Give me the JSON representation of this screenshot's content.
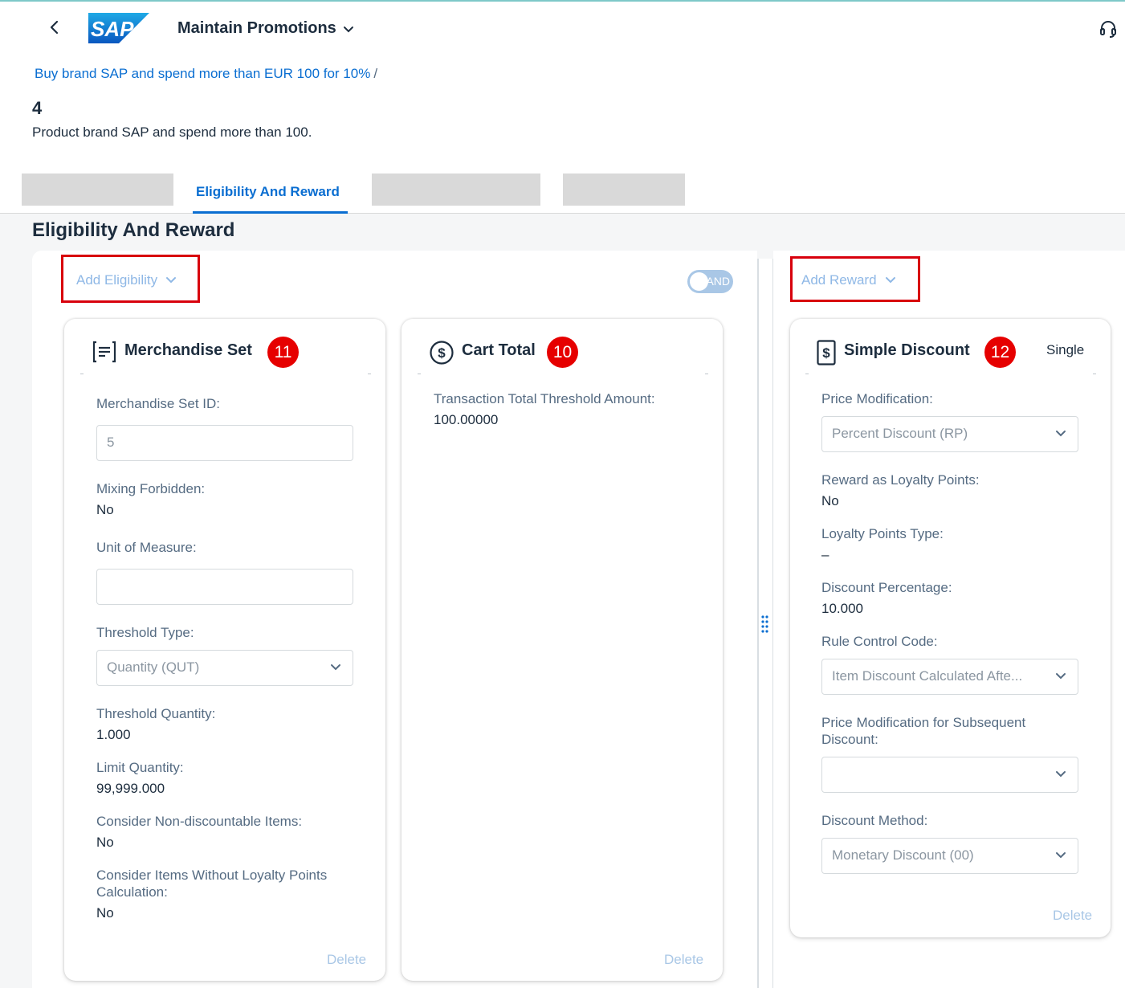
{
  "header": {
    "app_title": "Maintain Promotions",
    "logo_text": "SAP",
    "breadcrumb_link": "Buy brand SAP and spend more than EUR 100 for 10%",
    "breadcrumb_sep": "/",
    "object_title": "4",
    "object_subtitle": "Product brand SAP and spend more than 100."
  },
  "tabs": {
    "active_label": "Eligibility And Reward"
  },
  "section": {
    "title": "Eligibility And Reward"
  },
  "eligibility": {
    "add_label": "Add Eligibility",
    "toggle_label": "AND",
    "merch": {
      "title": "Merchandise Set",
      "badge": "11",
      "set_id_label": "Merchandise Set ID:",
      "set_id_value": "5",
      "mixing_label": "Mixing Forbidden:",
      "mixing_value": "No",
      "uom_label": "Unit of Measure:",
      "uom_value": "",
      "threshold_type_label": "Threshold Type:",
      "threshold_type_value": "Quantity (QUT)",
      "threshold_qty_label": "Threshold Quantity:",
      "threshold_qty_value": "1.000",
      "limit_qty_label": "Limit Quantity:",
      "limit_qty_value": "99,999.000",
      "non_disc_label": "Consider Non-discountable Items:",
      "non_disc_value": "No",
      "loyalty_label_1": "Consider Items Without Loyalty Points",
      "loyalty_label_2": "Calculation:",
      "loyalty_value": "No",
      "delete_label": "Delete"
    },
    "cart": {
      "title": "Cart Total",
      "badge": "10",
      "threshold_label": "Transaction Total Threshold Amount:",
      "threshold_value": "100.00000",
      "delete_label": "Delete"
    }
  },
  "reward": {
    "add_label": "Add Reward",
    "discount": {
      "title": "Simple Discount",
      "badge": "12",
      "mode": "Single",
      "price_mod_label": "Price Modification:",
      "price_mod_value": "Percent Discount (RP)",
      "loyalty_label": "Reward as Loyalty Points:",
      "loyalty_value": "No",
      "loyalty_type_label": "Loyalty Points Type:",
      "loyalty_type_value": "–",
      "percentage_label": "Discount Percentage:",
      "percentage_value": "10.000",
      "rule_label": "Rule Control Code:",
      "rule_value": "Item Discount Calculated Afte...",
      "subseq_label_1": "Price Modification for Subsequent",
      "subseq_label_2": "Discount:",
      "subseq_value": "",
      "method_label": "Discount Method:",
      "method_value": "Monetary Discount (00)",
      "delete_label": "Delete"
    }
  },
  "colors": {
    "accent": "#0a6ed1",
    "badge": "#e60000",
    "highlight_box": "#d8000c"
  }
}
